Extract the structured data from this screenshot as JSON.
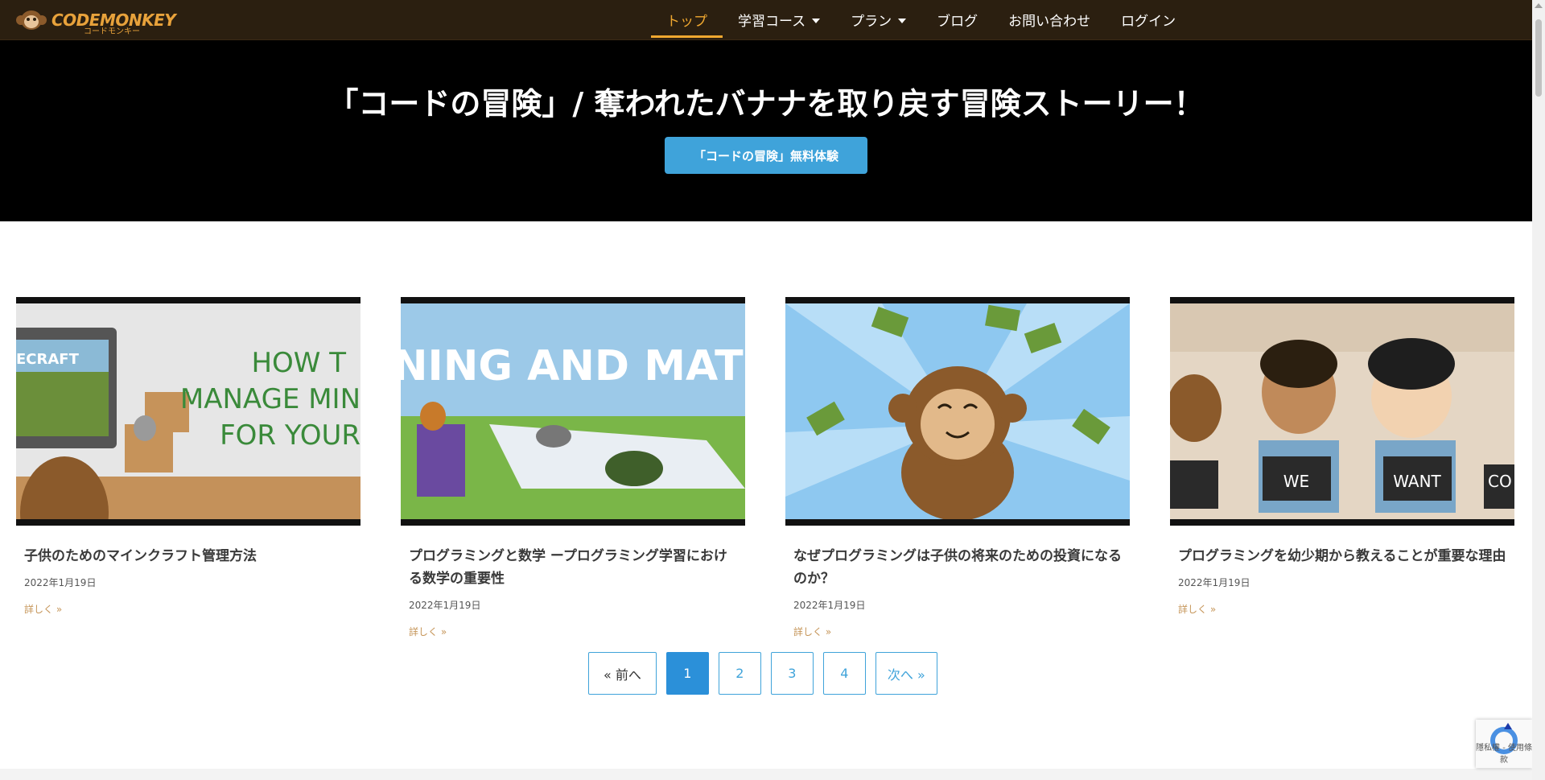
{
  "logo": {
    "word": "CODEMONKEY",
    "sub": "コードモンキー"
  },
  "nav": [
    {
      "label": "トップ",
      "active": true,
      "dropdown": false
    },
    {
      "label": "学習コース",
      "active": false,
      "dropdown": true
    },
    {
      "label": "プラン",
      "active": false,
      "dropdown": true
    },
    {
      "label": "ブログ",
      "active": false,
      "dropdown": false
    },
    {
      "label": "お問い合わせ",
      "active": false,
      "dropdown": false
    },
    {
      "label": "ログイン",
      "active": false,
      "dropdown": false
    }
  ],
  "hero": {
    "title": "「コードの冒険」/ 奪われたバナナを取り戻す冒険ストーリー！",
    "button": "「コードの冒険」無料体験"
  },
  "posts": [
    {
      "title": "子供のためのマインクラフト管理方法",
      "date": "2022年1月19日",
      "more": "詳しく »",
      "image_text": [
        "HOW T",
        "MANAGE MIN",
        "FOR YOUR"
      ],
      "image_badge": "ECRAFT"
    },
    {
      "title": "プログラミングと数学 ープログラミング学習における数学の重要性",
      "date": "2022年1月19日",
      "more": "詳しく »",
      "image_text": [
        "NING AND MATH"
      ]
    },
    {
      "title": "なぜプログラミングは子供の将来のための投資になるのか？",
      "date": "2022年1月19日",
      "more": "詳しく »",
      "image_text": []
    },
    {
      "title": "プログラミングを幼少期から教えることが重要な理由",
      "date": "2022年1月19日",
      "more": "詳しく »",
      "image_text": [
        "WE",
        "WANT",
        "CO"
      ]
    }
  ],
  "pagination": {
    "prev": "« 前へ",
    "pages": [
      "1",
      "2",
      "3",
      "4"
    ],
    "current": "1",
    "next": "次へ »"
  },
  "recaptcha": {
    "text": "隱私權 - 使用條款"
  },
  "colors": {
    "nav_bg": "#2b1f10",
    "accent": "#f0a830",
    "button": "#3fa3da",
    "page_current": "#2b90d9"
  }
}
